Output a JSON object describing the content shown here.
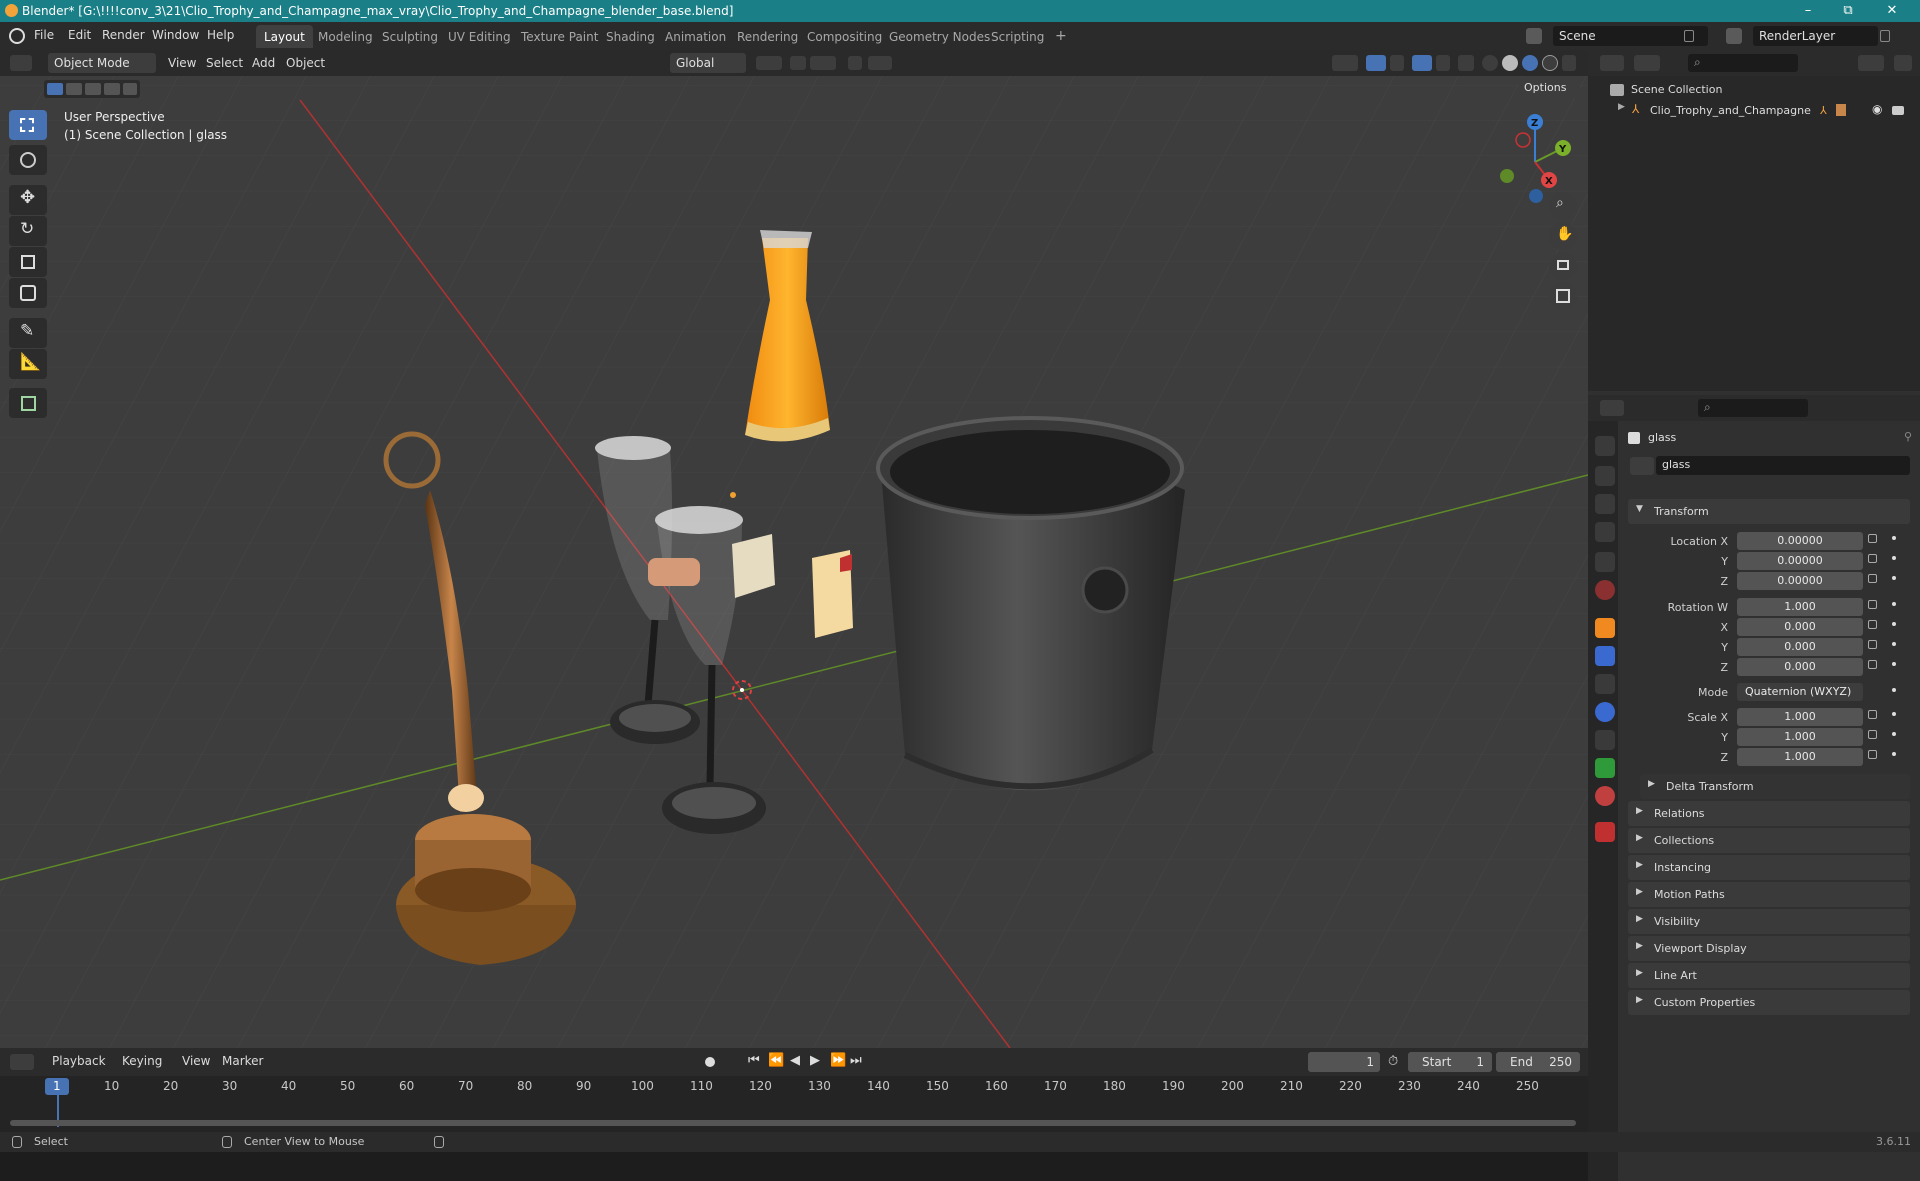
{
  "window": {
    "title": "Blender* [G:\\!!!!conv_3\\21\\Clio_Trophy_and_Champagne_max_vray\\Clio_Trophy_and_Champagne_blender_base.blend]",
    "minimize": "–",
    "maximize": "⧉",
    "close": "✕"
  },
  "menus": [
    "File",
    "Edit",
    "Render",
    "Window",
    "Help"
  ],
  "workspaces": [
    "Layout",
    "Modeling",
    "Sculpting",
    "UV Editing",
    "Texture Paint",
    "Shading",
    "Animation",
    "Rendering",
    "Compositing",
    "Geometry Nodes",
    "Scripting"
  ],
  "add_workspace": "+",
  "scene": {
    "name": "Scene",
    "render_layer": "RenderLayer"
  },
  "viewport": {
    "mode": "Object Mode",
    "menus": [
      "View",
      "Select",
      "Add",
      "Object"
    ],
    "orientation": "Global",
    "options": "Options",
    "info_line1": "User Perspective",
    "info_line2": "(1) Scene Collection | glass",
    "gizmo_labels": {
      "x": "X",
      "y": "Y",
      "z": "Z"
    }
  },
  "outliner": {
    "root": "Scene Collection",
    "items": [
      {
        "name": "Clio_Trophy_and_Champagne"
      }
    ]
  },
  "properties": {
    "object_name": "glass",
    "data_name": "glass",
    "transform": {
      "header": "Transform",
      "location_label": "Location X",
      "rotation_label": "Rotation W",
      "scale_label": "Scale X",
      "y_label": "Y",
      "z_label": "Z",
      "x_label": "X",
      "location": [
        "0.00000",
        "0.00000",
        "0.00000"
      ],
      "rotation": [
        "1.000",
        "0.000",
        "0.000",
        "0.000"
      ],
      "mode_label": "Mode",
      "mode": "Quaternion (WXYZ)",
      "scale": [
        "1.000",
        "1.000",
        "1.000"
      ],
      "delta": "Delta Transform"
    },
    "panels": [
      "Relations",
      "Collections",
      "Instancing",
      "Motion Paths",
      "Visibility",
      "Viewport Display",
      "Line Art",
      "Custom Properties"
    ]
  },
  "timeline": {
    "menus": [
      "Playback",
      "Keying",
      "View",
      "Marker"
    ],
    "current_frame": "1",
    "start_label": "Start",
    "start": "1",
    "end_label": "End",
    "end": "250",
    "ruler": [
      "1",
      "10",
      "20",
      "30",
      "40",
      "50",
      "60",
      "70",
      "80",
      "90",
      "100",
      "110",
      "120",
      "130",
      "140",
      "150",
      "160",
      "170",
      "180",
      "190",
      "200",
      "210",
      "220",
      "230",
      "240",
      "250"
    ]
  },
  "statusbar": {
    "select": "Select",
    "center": "Center View to Mouse",
    "version": "3.6.11"
  },
  "colors": {
    "accent": "#4772b3",
    "title_bar": "#1a7f86",
    "x_axis": "#c83232",
    "y_axis": "#6a9a2a",
    "z_axis": "#3a7fd5"
  }
}
